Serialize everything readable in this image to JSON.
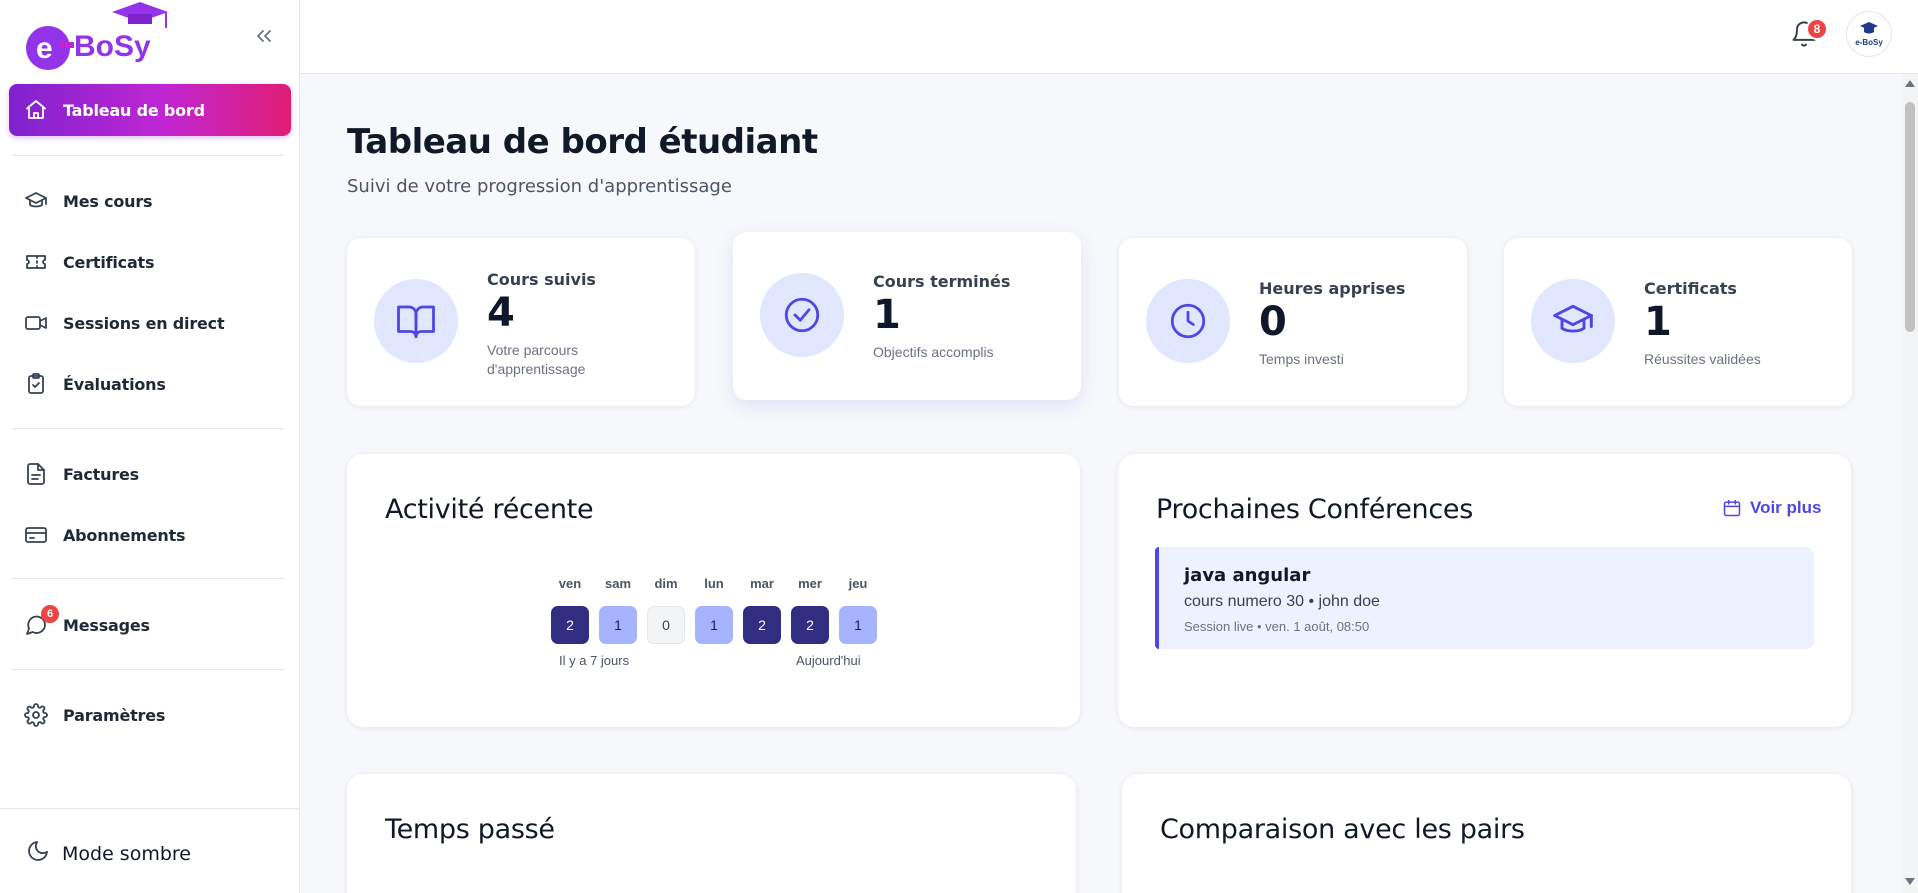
{
  "brand": {
    "logo_text": "eBoSy",
    "avatar_text": "e-BoSy"
  },
  "sidebar": {
    "items": [
      {
        "label": "Tableau de bord",
        "icon": "home-icon",
        "active": true
      },
      {
        "label": "Mes cours",
        "icon": "graduation-cap-icon"
      },
      {
        "label": "Certificats",
        "icon": "ticket-icon"
      },
      {
        "label": "Sessions en direct",
        "icon": "video-icon"
      },
      {
        "label": "Évaluations",
        "icon": "clipboard-check-icon"
      },
      {
        "label": "Factures",
        "icon": "file-text-icon"
      },
      {
        "label": "Abonnements",
        "icon": "credit-card-icon"
      },
      {
        "label": "Messages",
        "icon": "message-circle-icon",
        "badge": "6"
      },
      {
        "label": "Paramètres",
        "icon": "gear-icon"
      }
    ],
    "dark_mode_label": "Mode sombre"
  },
  "header": {
    "notification_count": "8"
  },
  "page": {
    "title": "Tableau de bord étudiant",
    "subtitle": "Suivi de votre progression d'apprentissage"
  },
  "stats": [
    {
      "label": "Cours suivis",
      "value": "4",
      "sub": "Votre parcours d'apprentissage",
      "icon": "book-open-icon"
    },
    {
      "label": "Cours terminés",
      "value": "1",
      "sub": "Objectifs accomplis",
      "icon": "check-circle-icon"
    },
    {
      "label": "Heures apprises",
      "value": "0",
      "sub": "Temps investi",
      "icon": "clock-icon"
    },
    {
      "label": "Certificats",
      "value": "1",
      "sub": "Réussites validées",
      "icon": "graduation-cap-icon"
    }
  ],
  "activity": {
    "title": "Activité récente",
    "days": [
      {
        "name": "ven",
        "count": "2"
      },
      {
        "name": "sam",
        "count": "1"
      },
      {
        "name": "dim",
        "count": "0"
      },
      {
        "name": "lun",
        "count": "1"
      },
      {
        "name": "mar",
        "count": "2"
      },
      {
        "name": "mer",
        "count": "2"
      },
      {
        "name": "jeu",
        "count": "1"
      }
    ],
    "legend_start": "Il y a 7 jours",
    "legend_end": "Aujourd'hui"
  },
  "conferences": {
    "title": "Prochaines Conférences",
    "see_more": "Voir plus",
    "items": [
      {
        "title": "java angular",
        "meta": "cours numero 30 • john doe",
        "time": "Session live • ven. 1 août, 08:50"
      }
    ]
  },
  "time_spent": {
    "title": "Temps passé"
  },
  "peers": {
    "title": "Comparaison avec les pairs"
  },
  "colors": {
    "accent": "#4f46e5",
    "active_gradient_start": "#7e22ce",
    "active_gradient_end": "#e11d74",
    "badge": "#ef4444",
    "activity_high": "#312e81",
    "activity_low": "#a5b4fc"
  }
}
